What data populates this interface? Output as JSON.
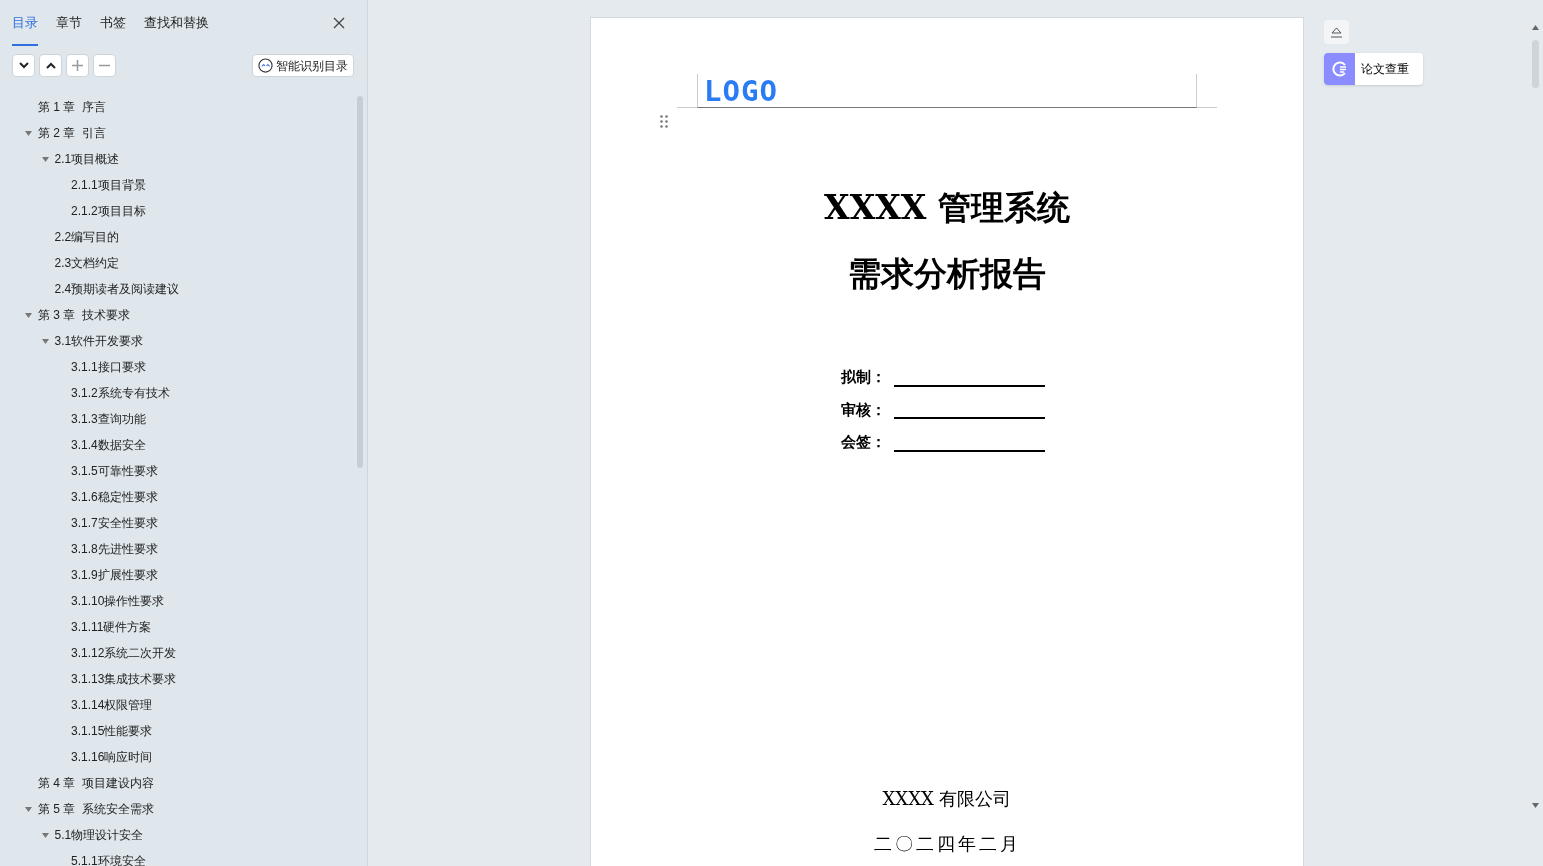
{
  "sidebar": {
    "tabs": [
      {
        "label": "目录",
        "selected": true
      },
      {
        "label": "章节",
        "selected": false
      },
      {
        "label": "书签",
        "selected": false
      },
      {
        "label": "查找和替换",
        "selected": false
      }
    ],
    "smart_button": "智能识别目录",
    "outline": [
      {
        "label": "第 1 章  序言"
      },
      {
        "label": "第 2 章  引言",
        "expanded": true,
        "children": [
          {
            "label": "2.1项目概述",
            "expanded": true,
            "children": [
              {
                "label": "2.1.1项目背景"
              },
              {
                "label": "2.1.2项目目标"
              }
            ]
          },
          {
            "label": "2.2编写目的"
          },
          {
            "label": "2.3文档约定"
          },
          {
            "label": "2.4预期读者及阅读建议"
          }
        ]
      },
      {
        "label": "第 3 章  技术要求",
        "expanded": true,
        "children": [
          {
            "label": "3.1软件开发要求",
            "expanded": true,
            "children": [
              {
                "label": "3.1.1接口要求"
              },
              {
                "label": "3.1.2系统专有技术"
              },
              {
                "label": "3.1.3查询功能"
              },
              {
                "label": "3.1.4数据安全"
              },
              {
                "label": "3.1.5可靠性要求"
              },
              {
                "label": "3.1.6稳定性要求"
              },
              {
                "label": "3.1.7安全性要求"
              },
              {
                "label": "3.1.8先进性要求"
              },
              {
                "label": "3.1.9扩展性要求"
              },
              {
                "label": "3.1.10操作性要求"
              },
              {
                "label": "3.1.11硬件方案"
              },
              {
                "label": "3.1.12系统二次开发"
              },
              {
                "label": "3.1.13集成技术要求"
              },
              {
                "label": "3.1.14权限管理"
              },
              {
                "label": "3.1.15性能要求"
              },
              {
                "label": "3.1.16响应时间"
              }
            ]
          }
        ]
      },
      {
        "label": "第 4 章  项目建设内容"
      },
      {
        "label": "第 5 章  系统安全需求",
        "expanded": true,
        "children": [
          {
            "label": "5.1物理设计安全",
            "expanded": true,
            "children": [
              {
                "label": "5.1.1环境安全"
              }
            ]
          }
        ]
      }
    ]
  },
  "document": {
    "logo": "LOGO",
    "title_lines": [
      "XXXX 管理系统",
      "需求分析报告"
    ],
    "sign_fields": [
      {
        "label": "拟制："
      },
      {
        "label": "审核："
      },
      {
        "label": "会签："
      }
    ],
    "company": "XXXX 有限公司",
    "date": "二〇二四年二月"
  },
  "side_tools": {
    "check_button": "论文查重"
  }
}
